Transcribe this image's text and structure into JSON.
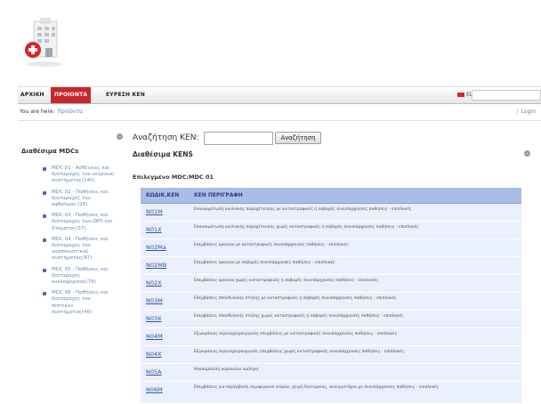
{
  "nav": {
    "home": "ΑΡΧΙΚΗ",
    "products": "ΠΡΟΙΟΝΤΑ",
    "find": "ΕΥΡΕΣΗ ΚΕΝ",
    "lang": "EL ▾"
  },
  "breadcrumb": {
    "prefix": "You are here:",
    "current": "Προϊόντα"
  },
  "login": {
    "sep": "|",
    "label": "Login"
  },
  "sidebar": {
    "title": "Διαθέσιμα MDCs",
    "items": [
      {
        "label": "MDC 01 - Ασθένειες και διαταραχές του νευρικού συστήματος(140)"
      },
      {
        "label": "MDC 02 - Παθήσεις και διαταραχές του οφθαλμού (26)"
      },
      {
        "label": "MDC 03 - Παθήσεις και διαταραχές των ΩΡΛ και Στόματος(37)"
      },
      {
        "label": "MDC 04 - Παθήσεις και διαταραχές του αναπνευστικού συστήματος(47)"
      },
      {
        "label": "MDC 05 - Παθήσεις και διαταραχές κυκλοφορικού(79)"
      },
      {
        "label": "MDC 06 - Παθήσεις και διαταραχές του πεπτικού συστήματος(46)"
      }
    ]
  },
  "search": {
    "label": "Αναζήτηση ΚΕΝ:",
    "button": "Αναζήτηση",
    "value": ""
  },
  "main": {
    "title": "Διαθέσιμα KENS",
    "selected": "Επιλεγμένο MDC:MDC 01"
  },
  "table": {
    "headers": {
      "code": "ΚΩΔΙΚ.ΚΕΝ",
      "desc": "ΚΕΝ ΠΕΡΙΓΡΑΦΗ"
    },
    "rows": [
      {
        "code": "N01M",
        "desc": "Επαναιμάτωση κοιλιακής παροχέτευσης με καταστροφικές ή σοβαρές συνυπάρχουσες παθήσεις - επιπλοκές"
      },
      {
        "code": "N01X",
        "desc": "Επαναιμάτωση κοιλιακής παροχέτευσης χωρίς καταστροφικές ή σοβαρές συνυπάρχουσες παθήσεις - επιπλοκές"
      },
      {
        "code": "N02Ma",
        "desc": "Επεμβάσεις κρανίου με καταστροφικές συνυπάρχουσες παθήσεις - επιπλοκές"
      },
      {
        "code": "N02MB",
        "desc": "Επεμβάσεις κρανίου με σοβαρές συνυπάρχουσες παθήσεις - επιπλοκές"
      },
      {
        "code": "N02X",
        "desc": "Επεμβάσεις κρανίου χωρίς καταστροφικές ή σοβαρές συνυπάρχουσες παθήσεις - επιπλοκές"
      },
      {
        "code": "N03M",
        "desc": "Επεμβάσεις σπονδυλικής στήλης με καταστροφικές ή σοβαρές συνυπάρχουσες παθήσεις - επιπλοκές"
      },
      {
        "code": "N03X",
        "desc": "Επεμβάσεις σπονδυλικής στήλης χωρίς καταστροφικές ή σοβαρές συνυπάρχουσες παθήσεις - επιπλοκές"
      },
      {
        "code": "N04M",
        "desc": "Εξωκράνιες αγγειοχειρουργικές επεμβάσεις με καταστροφικές συνυπάρχουσες παθήσεις - επιπλοκές"
      },
      {
        "code": "N04X",
        "desc": "Εξωκράνιες αγγειοχειρουργικές επεμβάσεις χωρίς καταστροφικές συνυπάρχουσες παθήσεις - επιπλοκές"
      },
      {
        "code": "N05A",
        "desc": "Αποσυμπίεση καρπιαίου σωλήνα"
      },
      {
        "code": "N06M",
        "desc": "Επεμβάσεις για παρέμβαση περιφερικού νεύρου, χειρή διατομείας, ανοιγματάριο με συνυπάρχουσες παθήσεις - επιπλοκές"
      }
    ]
  }
}
